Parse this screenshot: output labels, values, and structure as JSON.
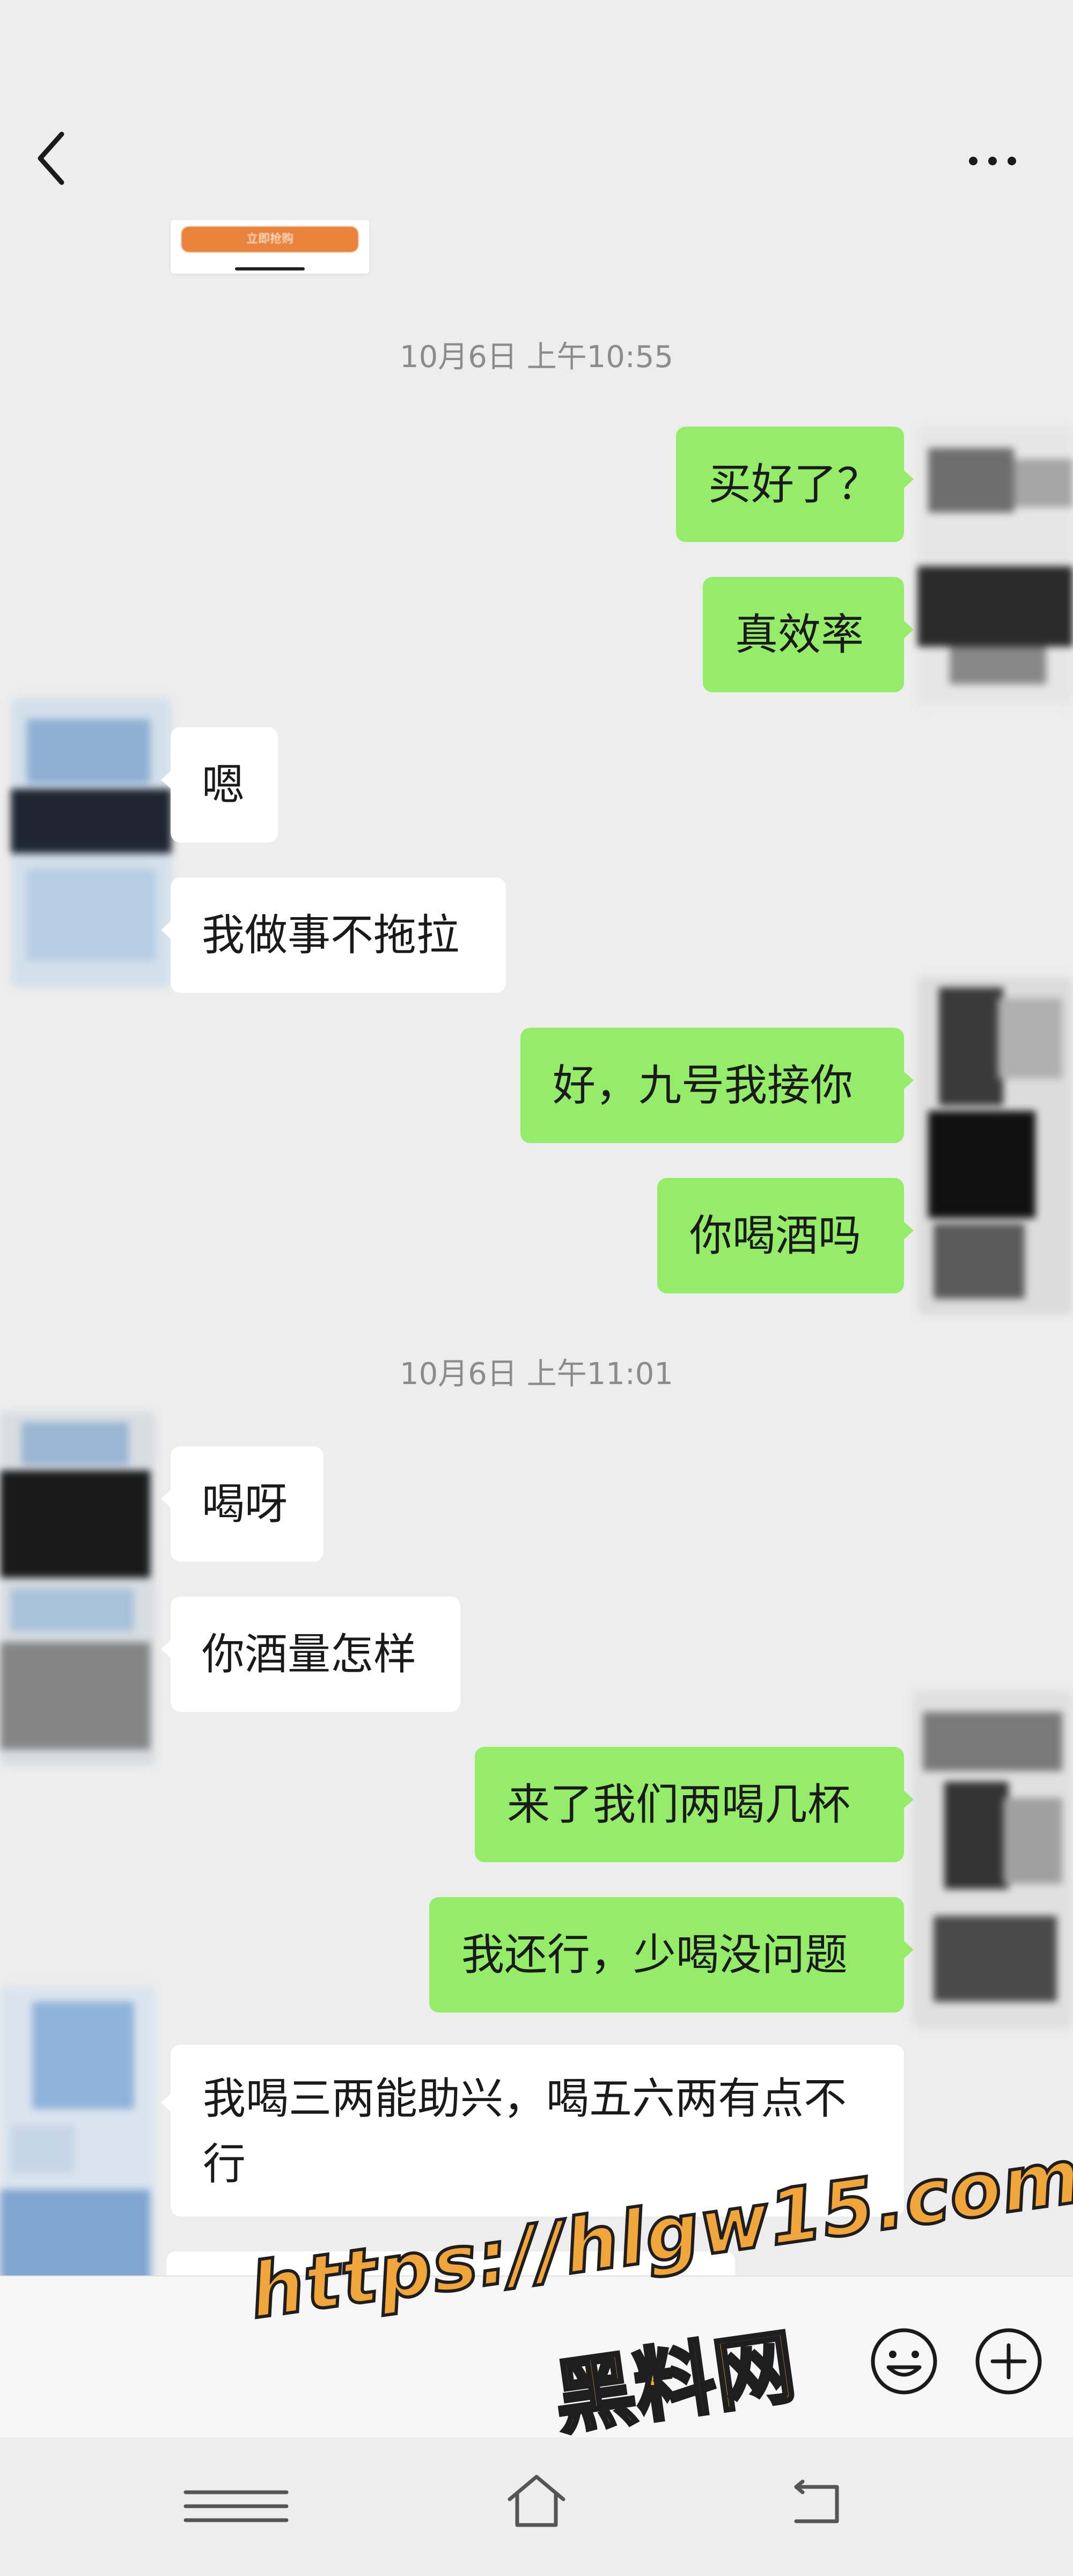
{
  "header": {
    "title": "",
    "back_icon": "chevron-left-icon",
    "more_icon": "more-dots-icon"
  },
  "shared_card": {
    "label": "立即抢购"
  },
  "timestamps": [
    "10月6日 上午10:55",
    "10月6日 上午11:01"
  ],
  "messages": [
    {
      "side": "right",
      "text": "买好了？"
    },
    {
      "side": "right",
      "text": "真效率"
    },
    {
      "side": "left",
      "text": "嗯"
    },
    {
      "side": "left",
      "text": "我做事不拖拉"
    },
    {
      "side": "right",
      "text": "好，九号我接你"
    },
    {
      "side": "right",
      "text": "你喝酒吗"
    },
    {
      "side": "left",
      "text": "喝呀"
    },
    {
      "side": "left",
      "text": "你酒量怎样"
    },
    {
      "side": "right",
      "text": "来了我们两喝几杯"
    },
    {
      "side": "right",
      "text": "我还行，少喝没问题"
    },
    {
      "side": "left",
      "text": "我喝三两能助兴，喝五六两有点不行"
    }
  ],
  "input_bar": {
    "emoji_icon": "emoji-smile-icon",
    "plus_icon": "plus-circle-icon"
  },
  "nav_bar": {
    "menu_icon": "menu-lines-icon",
    "home_icon": "home-icon",
    "back_icon": "return-icon"
  },
  "watermark": {
    "url": "https://hlgw15.com",
    "name": "黑料网"
  },
  "colors": {
    "background": "#ededed",
    "bubble_self": "#95ec69",
    "bubble_other": "#ffffff",
    "timestamp": "#8c8c8c",
    "watermark": "#f0a63a"
  }
}
